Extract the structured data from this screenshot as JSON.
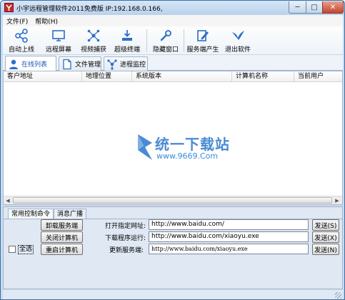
{
  "window": {
    "title": "小宇远程管理软件2011免费版 IP:192.168.0.166,",
    "controls": {
      "minimize": "─",
      "maximize": "□",
      "close": "✕"
    }
  },
  "menu": [
    "文件(F)",
    "帮助(H)"
  ],
  "toolbar": [
    {
      "label": "自动上线",
      "icon": "share-nodes-icon"
    },
    {
      "label": "远程屏幕",
      "icon": "monitor-icon"
    },
    {
      "label": "视频捕获",
      "icon": "network-hub-icon"
    },
    {
      "label": "超级终端",
      "icon": "download-drive-icon"
    },
    {
      "label": "隐藏窗口",
      "icon": "wrench-icon"
    },
    {
      "label": "服务端产生",
      "icon": "edit-document-icon"
    },
    {
      "label": "退出软件",
      "icon": "bird-exit-icon"
    }
  ],
  "tabs": [
    {
      "label": "在线列表",
      "icon": "user-icon",
      "active": true
    },
    {
      "label": "文件管理",
      "icon": "file-icon",
      "active": false
    },
    {
      "label": "进程监控",
      "icon": "process-nodes-icon",
      "active": false
    }
  ],
  "list": {
    "columns": [
      "客户地址",
      "地理位置",
      "系统版本",
      "计算机名称",
      "当前用户"
    ],
    "rows": []
  },
  "watermark": {
    "title": "统一下载站",
    "url": "www.9669.Com"
  },
  "bottom_tabs": [
    {
      "label": "常用控制命令",
      "active": true
    },
    {
      "label": "消息广播",
      "active": false
    }
  ],
  "commands": {
    "buttons": [
      "卸载服务端",
      "关闭计算机",
      "重启计算机"
    ],
    "select_all": "全选"
  },
  "fields": [
    {
      "label": "打开指定网址:",
      "value": "http://www.baidu.com/",
      "send": "发送(S)"
    },
    {
      "label": "下载程序运行:",
      "value": "http://www.baidu.com/xiaoyu.exe",
      "send": "发送(X)"
    },
    {
      "label": "更新服务端:",
      "value": "http://www.baidu.com/xiaoyu.exe",
      "send": "发送(N)"
    }
  ],
  "colors": {
    "accent": "#1a56b0",
    "frame": "#c8dbee",
    "watermark": "#4a8ad4"
  }
}
